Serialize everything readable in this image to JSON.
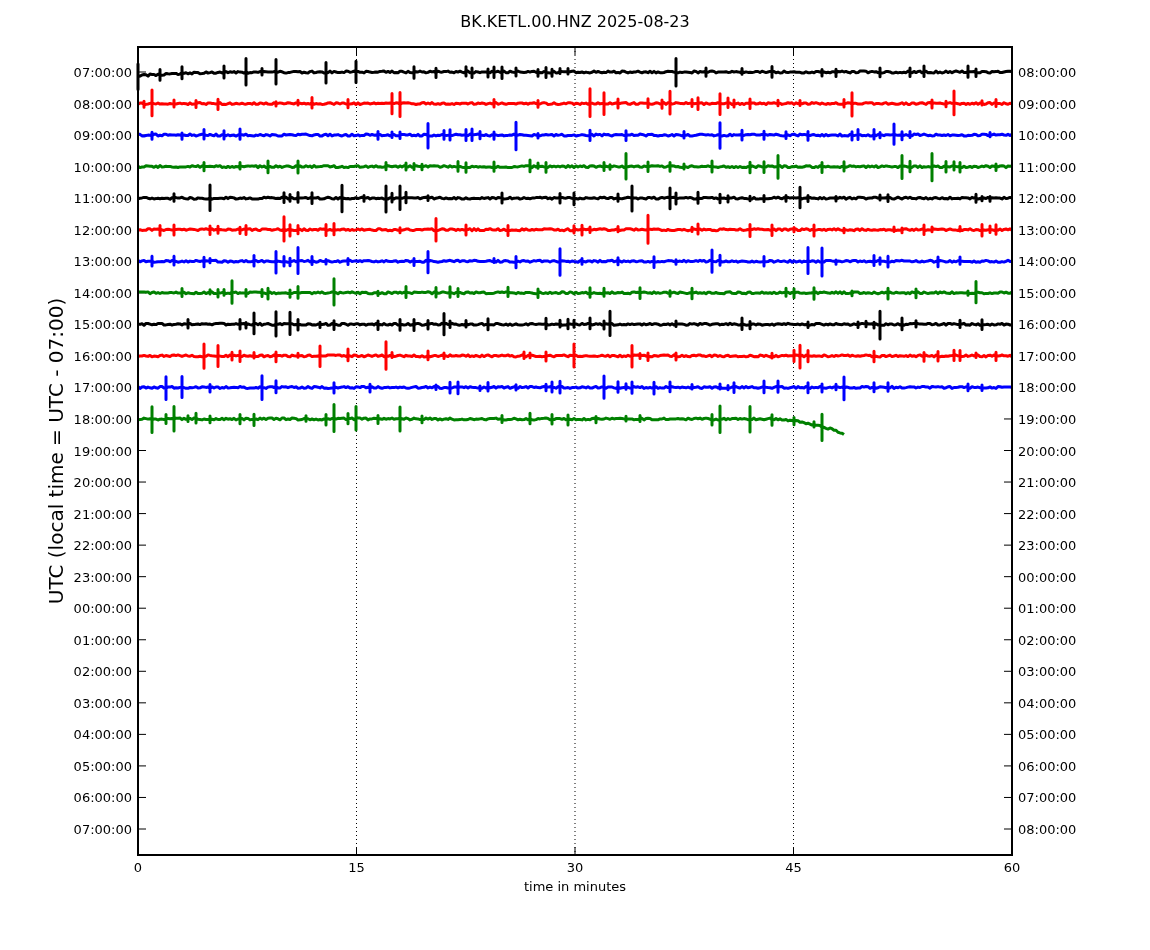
{
  "title": "BK.KETL.00.HNZ 2025-08-23",
  "ylabel": "UTC (local time = UTC - 07:00)",
  "xlabel": "time in minutes",
  "xticks": [
    "0",
    "15",
    "30",
    "45",
    "60"
  ],
  "left_ticks": [
    "07:00:00",
    "08:00:00",
    "09:00:00",
    "10:00:00",
    "11:00:00",
    "12:00:00",
    "13:00:00",
    "14:00:00",
    "15:00:00",
    "16:00:00",
    "17:00:00",
    "18:00:00",
    "19:00:00",
    "20:00:00",
    "21:00:00",
    "22:00:00",
    "23:00:00",
    "00:00:00",
    "01:00:00",
    "02:00:00",
    "03:00:00",
    "04:00:00",
    "05:00:00",
    "06:00:00",
    "07:00:00"
  ],
  "right_ticks": [
    "08:00:00",
    "09:00:00",
    "10:00:00",
    "11:00:00",
    "12:00:00",
    "13:00:00",
    "14:00:00",
    "15:00:00",
    "16:00:00",
    "17:00:00",
    "18:00:00",
    "19:00:00",
    "20:00:00",
    "21:00:00",
    "22:00:00",
    "23:00:00",
    "00:00:00",
    "01:00:00",
    "02:00:00",
    "03:00:00",
    "04:00:00",
    "05:00:00",
    "06:00:00",
    "07:00:00",
    "08:00:00"
  ],
  "traces": [
    {
      "color": "#000000",
      "kind": "full"
    },
    {
      "color": "#ff0000",
      "kind": "full"
    },
    {
      "color": "#0000ff",
      "kind": "full"
    },
    {
      "color": "#008000",
      "kind": "full"
    },
    {
      "color": "#000000",
      "kind": "full"
    },
    {
      "color": "#ff0000",
      "kind": "full"
    },
    {
      "color": "#0000ff",
      "kind": "full"
    },
    {
      "color": "#008000",
      "kind": "full"
    },
    {
      "color": "#000000",
      "kind": "full"
    },
    {
      "color": "#ff0000",
      "kind": "full"
    },
    {
      "color": "#0000ff",
      "kind": "full"
    },
    {
      "color": "#008000",
      "kind": "partial"
    }
  ]
}
